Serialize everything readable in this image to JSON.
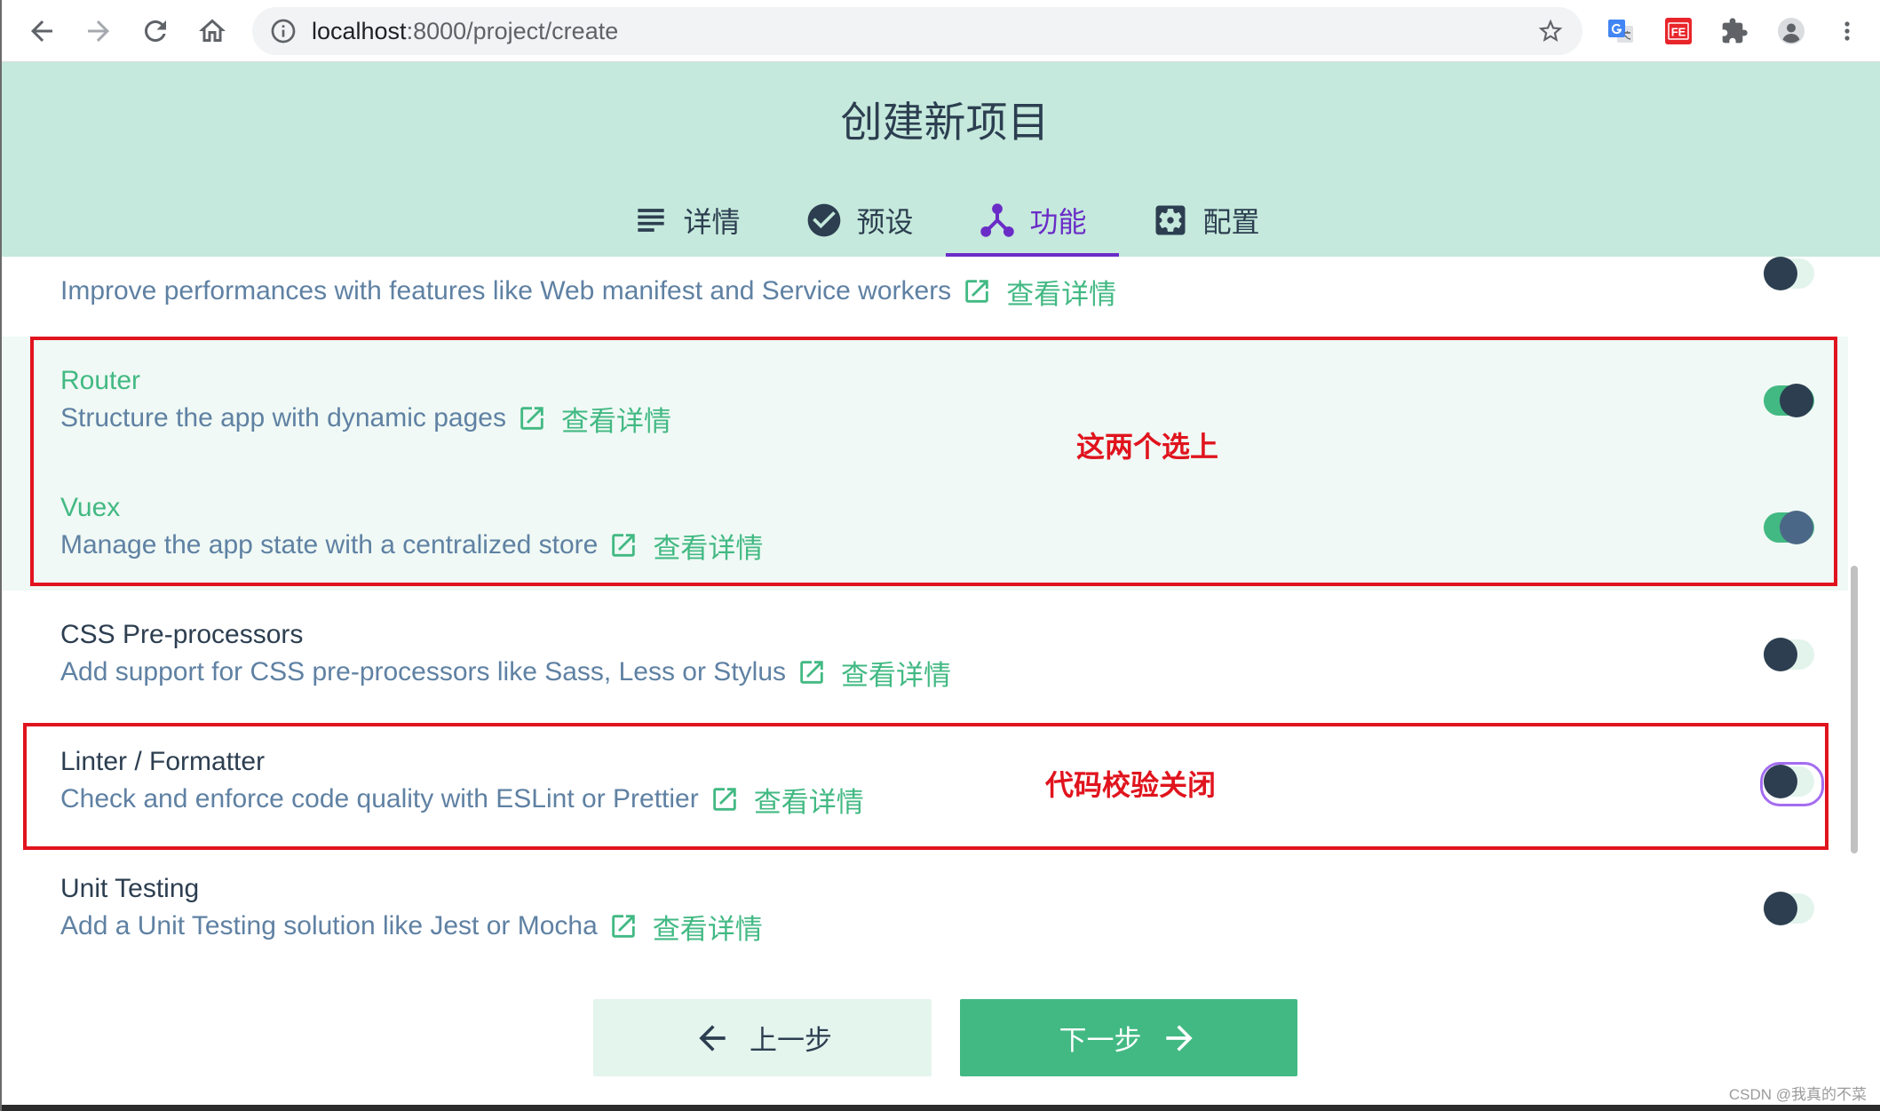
{
  "browser": {
    "url_host": "localhost",
    "url_path": ":8000/project/create",
    "fe_extension_label": "FE",
    "icons": [
      "back-arrow-icon",
      "forward-arrow-icon",
      "reload-icon",
      "home-icon",
      "info-icon",
      "star-icon",
      "google-translate-icon",
      "fe-helper-icon",
      "extensions-puzzle-icon",
      "profile-avatar-icon",
      "more-vert-icon"
    ]
  },
  "header": {
    "title": "创建新项目",
    "tabs": [
      {
        "label": "详情",
        "icon": "list-icon"
      },
      {
        "label": "预设",
        "icon": "check-circle-icon"
      },
      {
        "label": "功能",
        "icon": "feature-tree-icon",
        "active": true
      },
      {
        "label": "配置",
        "icon": "settings-icon"
      }
    ]
  },
  "features": [
    {
      "description": "Improve performances with features like Web manifest and Service workers",
      "link": "查看详情",
      "enabled": false
    },
    {
      "title": "Router",
      "description": "Structure the app with dynamic pages",
      "link": "查看详情",
      "enabled": true
    },
    {
      "title": "Vuex",
      "description": "Manage the app state with a centralized store",
      "link": "查看详情",
      "enabled": true,
      "hovered": true
    },
    {
      "title": "CSS Pre-processors",
      "description": "Add support for CSS pre-processors like Sass, Less or Stylus",
      "link": "查看详情",
      "enabled": false
    },
    {
      "title": "Linter / Formatter",
      "description": "Check and enforce code quality with ESLint or Prettier",
      "link": "查看详情",
      "enabled": false,
      "focused": true
    },
    {
      "title": "Unit Testing",
      "description": "Add a Unit Testing solution like Jest or Mocha",
      "link": "查看详情",
      "enabled": false
    }
  ],
  "annotations": {
    "select_note": "这两个选上",
    "linter_note": "代码校验关闭"
  },
  "nav_buttons": {
    "prev": "上一步",
    "next": "下一步"
  },
  "watermark": "CSDN @我真的不菜",
  "colors": {
    "accent": "#42b983",
    "header-bg": "#c5e9dc",
    "active": "#6a2cc7",
    "text": "#2c3e50",
    "desc": "#5f81a3",
    "annot": "#e0141e"
  }
}
